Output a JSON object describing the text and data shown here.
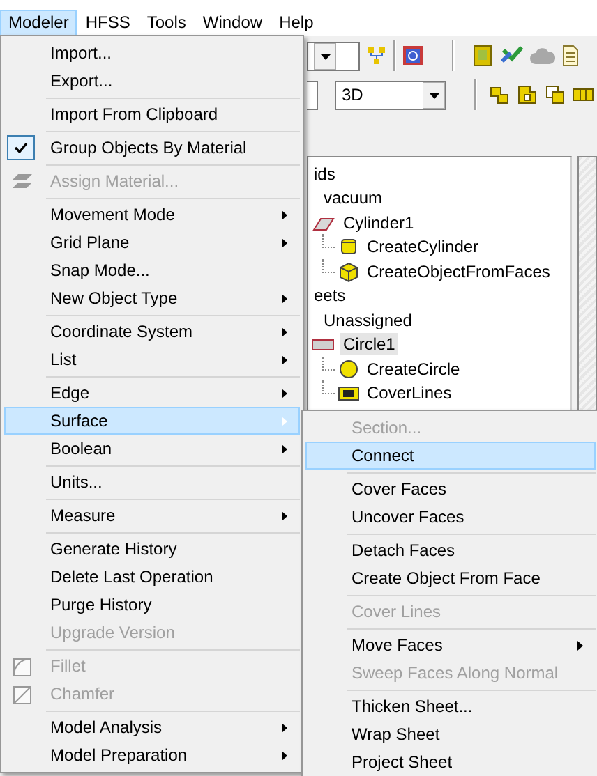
{
  "menubar": [
    {
      "label": "Modeler",
      "selected": true
    },
    {
      "label": "HFSS",
      "selected": false
    },
    {
      "label": "Tools",
      "selected": false
    },
    {
      "label": "Window",
      "selected": false
    },
    {
      "label": "Help",
      "selected": false
    }
  ],
  "toolbar": {
    "view_dropdown": {
      "value": "3D"
    }
  },
  "tree": [
    {
      "label": "ids",
      "selected": false,
      "children": [
        {
          "label": "vacuum",
          "selected": false,
          "children": [
            {
              "label": "Cylinder1",
              "kind": "solid",
              "selected": false,
              "children": [
                {
                  "label": "CreateCylinder",
                  "kind": "cylinder-op",
                  "selected": false
                },
                {
                  "label": "CreateObjectFromFaces",
                  "kind": "faces-op",
                  "selected": false
                }
              ]
            }
          ]
        }
      ]
    },
    {
      "label": "eets",
      "selected": false,
      "children": [
        {
          "label": "Unassigned",
          "selected": false,
          "children": [
            {
              "label": "Circle1",
              "kind": "sheet",
              "selected": true,
              "children": [
                {
                  "label": "CreateCircle",
                  "kind": "circle-op",
                  "selected": false
                },
                {
                  "label": "CoverLines",
                  "kind": "lines-op",
                  "selected": false
                }
              ]
            }
          ]
        }
      ]
    }
  ],
  "modeler_menu": {
    "sections": [
      {
        "items": [
          {
            "label": "Import...",
            "checked": false,
            "disabled": false,
            "selected": false,
            "submenu": false
          },
          {
            "label": "Export...",
            "checked": false,
            "disabled": false,
            "selected": false,
            "submenu": false
          }
        ]
      },
      {
        "items": [
          {
            "label": "Import From Clipboard",
            "checked": false,
            "disabled": false,
            "selected": false,
            "submenu": false
          }
        ]
      },
      {
        "items": [
          {
            "label": "Group Objects By Material",
            "checked": true,
            "disabled": false,
            "selected": false,
            "submenu": false
          }
        ]
      },
      {
        "items": [
          {
            "label": "Assign Material...",
            "kind": "material",
            "checked": false,
            "disabled": true,
            "selected": false,
            "submenu": false
          }
        ]
      },
      {
        "items": [
          {
            "label": "Movement Mode",
            "checked": false,
            "disabled": false,
            "selected": false,
            "submenu": true
          },
          {
            "label": "Grid Plane",
            "checked": false,
            "disabled": false,
            "selected": false,
            "submenu": true
          },
          {
            "label": "Snap Mode...",
            "checked": false,
            "disabled": false,
            "selected": false,
            "submenu": false
          },
          {
            "label": "New Object Type",
            "checked": false,
            "disabled": false,
            "selected": false,
            "submenu": true
          }
        ]
      },
      {
        "items": [
          {
            "label": "Coordinate System",
            "checked": false,
            "disabled": false,
            "selected": false,
            "submenu": true
          },
          {
            "label": "List",
            "checked": false,
            "disabled": false,
            "selected": false,
            "submenu": true
          }
        ]
      },
      {
        "items": [
          {
            "label": "Edge",
            "checked": false,
            "disabled": false,
            "selected": false,
            "submenu": true
          },
          {
            "label": "Surface",
            "checked": false,
            "disabled": false,
            "selected": true,
            "submenu": true
          },
          {
            "label": "Boolean",
            "checked": false,
            "disabled": false,
            "selected": false,
            "submenu": true
          }
        ]
      },
      {
        "items": [
          {
            "label": "Units...",
            "checked": false,
            "disabled": false,
            "selected": false,
            "submenu": false
          }
        ]
      },
      {
        "items": [
          {
            "label": "Measure",
            "checked": false,
            "disabled": false,
            "selected": false,
            "submenu": true
          }
        ]
      },
      {
        "items": [
          {
            "label": "Generate History",
            "checked": false,
            "disabled": false,
            "selected": false,
            "submenu": false
          },
          {
            "label": "Delete Last Operation",
            "checked": false,
            "disabled": false,
            "selected": false,
            "submenu": false
          },
          {
            "label": "Purge History",
            "checked": false,
            "disabled": false,
            "selected": false,
            "submenu": false
          },
          {
            "label": "Upgrade Version",
            "checked": false,
            "disabled": true,
            "selected": false,
            "submenu": false
          }
        ]
      },
      {
        "items": [
          {
            "label": "Fillet",
            "kind": "fillet",
            "checked": false,
            "disabled": true,
            "selected": false,
            "submenu": false
          },
          {
            "label": "Chamfer",
            "kind": "chamfer",
            "checked": false,
            "disabled": true,
            "selected": false,
            "submenu": false
          }
        ]
      },
      {
        "items": [
          {
            "label": "Model Analysis",
            "checked": false,
            "disabled": false,
            "selected": false,
            "submenu": true
          },
          {
            "label": "Model Preparation",
            "checked": false,
            "disabled": false,
            "selected": false,
            "submenu": true
          }
        ]
      }
    ]
  },
  "surface_menu": {
    "sections": [
      {
        "items": [
          {
            "label": "Section...",
            "disabled": true,
            "selected": false,
            "submenu": false
          },
          {
            "label": "Connect",
            "disabled": false,
            "selected": true,
            "submenu": false
          }
        ]
      },
      {
        "items": [
          {
            "label": "Cover Faces",
            "disabled": false,
            "selected": false,
            "submenu": false
          },
          {
            "label": "Uncover Faces",
            "disabled": false,
            "selected": false,
            "submenu": false
          }
        ]
      },
      {
        "items": [
          {
            "label": "Detach Faces",
            "disabled": false,
            "selected": false,
            "submenu": false
          },
          {
            "label": "Create Object From Face",
            "disabled": false,
            "selected": false,
            "submenu": false
          }
        ]
      },
      {
        "items": [
          {
            "label": "Cover Lines",
            "disabled": true,
            "selected": false,
            "submenu": false
          }
        ]
      },
      {
        "items": [
          {
            "label": "Move Faces",
            "disabled": false,
            "selected": false,
            "submenu": true
          },
          {
            "label": "Sweep Faces Along Normal",
            "disabled": true,
            "selected": false,
            "submenu": false
          }
        ]
      },
      {
        "items": [
          {
            "label": "Thicken Sheet...",
            "disabled": false,
            "selected": false,
            "submenu": false
          },
          {
            "label": "Wrap Sheet",
            "disabled": false,
            "selected": false,
            "submenu": false
          },
          {
            "label": "Project Sheet",
            "disabled": false,
            "selected": false,
            "submenu": false
          }
        ]
      }
    ]
  }
}
